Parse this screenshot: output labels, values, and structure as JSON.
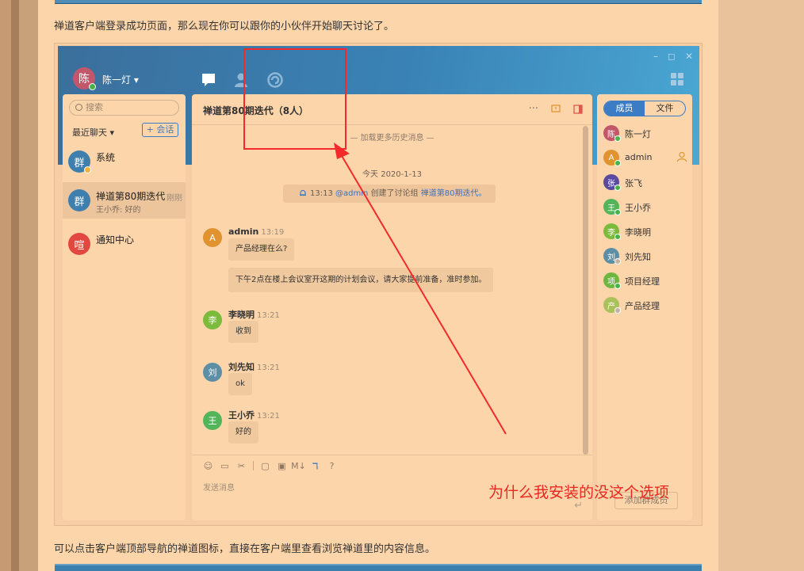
{
  "doc": {
    "intro": "禅道客户端登录成功页面，那么现在你可以跟你的小伙伴开始聊天讨论了。",
    "outro": "可以点击客户端顶部导航的禅道图标，直接在客户端里查看浏览禅道里的内容信息。"
  },
  "app": {
    "user": {
      "avatar": "陈",
      "name": "陈一灯 ▾"
    },
    "window_controls": [
      "–",
      "◻",
      "✕"
    ],
    "search_placeholder": "搜索",
    "recent_label": "最近聊天 ▾",
    "new_chat_label": "+ 会话",
    "conversations": [
      {
        "avatar": "群",
        "name": "系统",
        "subtitle": "",
        "time": "",
        "color": "#3e7fae"
      },
      {
        "avatar": "群",
        "name": "禅道第80期迭代",
        "subtitle": "王小乔: 好的",
        "time": "刚刚",
        "color": "#3e7fae"
      },
      {
        "avatar": "喧",
        "name": "通知中心",
        "subtitle": "",
        "time": "",
        "color": "#e2483f"
      }
    ],
    "chat": {
      "title": "禅道第80期迭代（8人）",
      "load_more": "— 加载更多历史消息 —",
      "date_separator": "今天 2020-1-13",
      "system_notice": {
        "time": "13:13",
        "mention": "@admin",
        "action": "创建了讨论组",
        "group": "禅道第80期迭代。"
      },
      "messages": [
        {
          "avatar": "A",
          "color": "#e0932f",
          "sender": "admin",
          "time": "13:19",
          "bubbles": [
            "产品经理在么?",
            "下午2点在楼上会议室开这期的计划会议，请大家提前准备，准时参加。"
          ]
        },
        {
          "avatar": "李",
          "color": "#7cba3c",
          "sender": "李晓明",
          "time": "13:21",
          "bubbles": [
            "收到"
          ]
        },
        {
          "avatar": "刘",
          "color": "#5c8ea6",
          "sender": "刘先知",
          "time": "13:21",
          "bubbles": [
            "ok"
          ]
        },
        {
          "avatar": "王",
          "color": "#52b55a",
          "sender": "王小乔",
          "time": "13:21",
          "bubbles": [
            "好的"
          ]
        }
      ],
      "toolbar": [
        "☺",
        "▭",
        "✂",
        "|",
        "▢",
        "▣",
        "M↓",
        "ℸ",
        "?"
      ],
      "composer_placeholder": "发送消息",
      "send_icon": "↵"
    },
    "members_panel": {
      "tabs": [
        "成员",
        "文件"
      ],
      "members": [
        {
          "avatar": "陈",
          "name": "陈一灯",
          "color": "#c2566b",
          "online": true
        },
        {
          "avatar": "A",
          "name": "admin",
          "color": "#e0932f",
          "online": true
        },
        {
          "avatar": "张",
          "name": "张飞",
          "color": "#5a4aa0",
          "online": true
        },
        {
          "avatar": "王",
          "name": "王小乔",
          "color": "#52b55a",
          "online": true
        },
        {
          "avatar": "李",
          "name": "李晓明",
          "color": "#7cba3c",
          "online": true
        },
        {
          "avatar": "刘",
          "name": "刘先知",
          "color": "#5c8ea6",
          "online": false
        },
        {
          "avatar": "项",
          "name": "项目经理",
          "color": "#6fb640",
          "online": true
        },
        {
          "avatar": "产",
          "name": "产品经理",
          "color": "#a9c15a",
          "online": false
        }
      ],
      "add_member_label": "添加群成员"
    }
  },
  "annotation": {
    "text": "为什么我安装的没这个选项",
    "color": "#e8281f"
  }
}
